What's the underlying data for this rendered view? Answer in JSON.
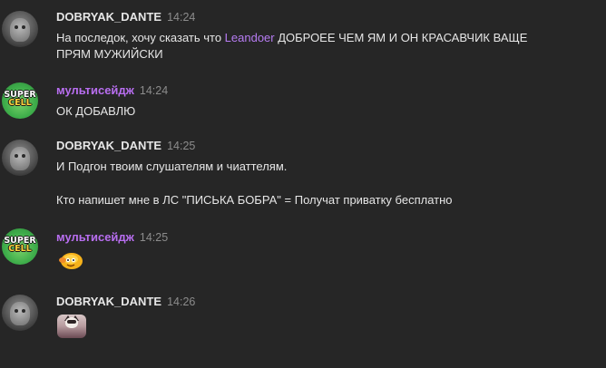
{
  "messages": [
    {
      "username": "DOBRYAK_DANTE",
      "time": "14:24",
      "lines": [
        "На последок, хочу сказать что ",
        "Leandoer",
        " ДОБРОЕЕ ЧЕМ ЯМ И ОН КРАСАВЧИК ВАЩЕ",
        "ПРЯМ МУЖИЙСКИ"
      ]
    },
    {
      "username": "мультисейдж",
      "time": "14:24",
      "avatar_text_top": "SUPER",
      "avatar_text_bottom": "CELL",
      "text": "ОК ДОБАВЛЮ"
    },
    {
      "username": "DOBRYAK_DANTE",
      "time": "14:25",
      "line1": "И Подгон твоим слушателям и чиаттелям.",
      "line2": "Кто напишет мне в ЛС \"ПИСЬКА БОБРА\" = Получат приватку бесплатно"
    },
    {
      "username": "мультисейдж",
      "time": "14:25",
      "avatar_text_top": "SUPER",
      "avatar_text_bottom": "CELL",
      "emoji": "blushing-smiley-emoji"
    },
    {
      "username": "DOBRYAK_DANTE",
      "time": "14:26",
      "sticker": "cat-sticker"
    }
  ],
  "colors": {
    "background": "#262626",
    "text": "#e6e6e6",
    "timestamp": "#8c8c8c",
    "username_multi": "#b86ef0",
    "mention": "#b77cf3"
  }
}
